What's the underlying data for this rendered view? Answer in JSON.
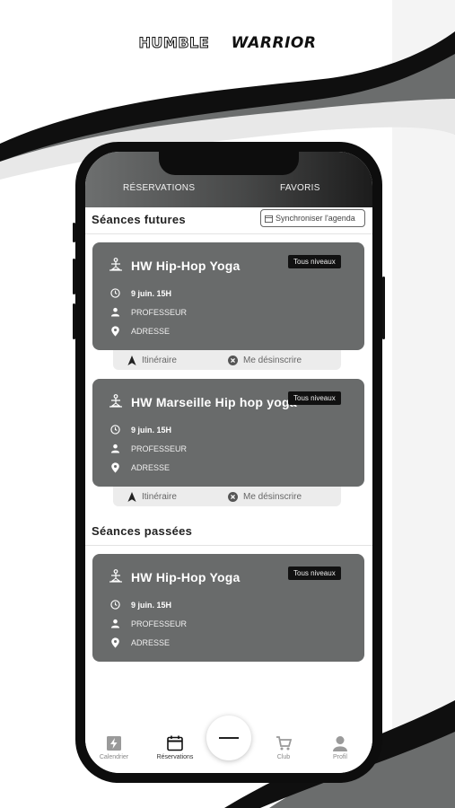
{
  "brand": {
    "part1": "HUMBLE",
    "part2": "WARRIOR"
  },
  "tabs": {
    "reservations": "RÉSERVATIONS",
    "favorites": "FAVORIS"
  },
  "upcoming": {
    "title": "Séances futures",
    "sync_label": "Synchroniser l'agenda",
    "cards": [
      {
        "title": "HW Hip-Hop Yoga",
        "badge": "Tous niveaux",
        "date": "9 juin. 15H",
        "teacher": "PROFESSEUR",
        "address": "ADRESSE",
        "action_route": "Itinéraire",
        "action_cancel": "Me désinscrire"
      },
      {
        "title": "HW Marseille Hip hop yoga",
        "badge": "Tous niveaux",
        "date": "9 juin. 15H",
        "teacher": "PROFESSEUR",
        "address": "ADRESSE",
        "action_route": "Itinéraire",
        "action_cancel": "Me désinscrire"
      }
    ]
  },
  "past": {
    "title": "Séances passées",
    "cards": [
      {
        "title": "HW Hip-Hop Yoga",
        "badge": "Tous niveaux",
        "date": "9 juin. 15H",
        "teacher": "PROFESSEUR",
        "address": "ADRESSE"
      }
    ]
  },
  "nav": {
    "calendar": "Calendrier",
    "reservations": "Réservations",
    "club": "Club",
    "profile": "Profil"
  },
  "icons": {
    "yoga": "yoga-pose-icon",
    "clock": "clock-icon",
    "person": "person-icon",
    "pin": "location-pin-icon",
    "navigate": "navigation-arrow-icon",
    "cancel": "cancel-circle-icon",
    "calendar": "calendar-icon"
  },
  "colors": {
    "card": "#696b6b",
    "badge": "#111111",
    "accent": "#1c1c1c"
  }
}
